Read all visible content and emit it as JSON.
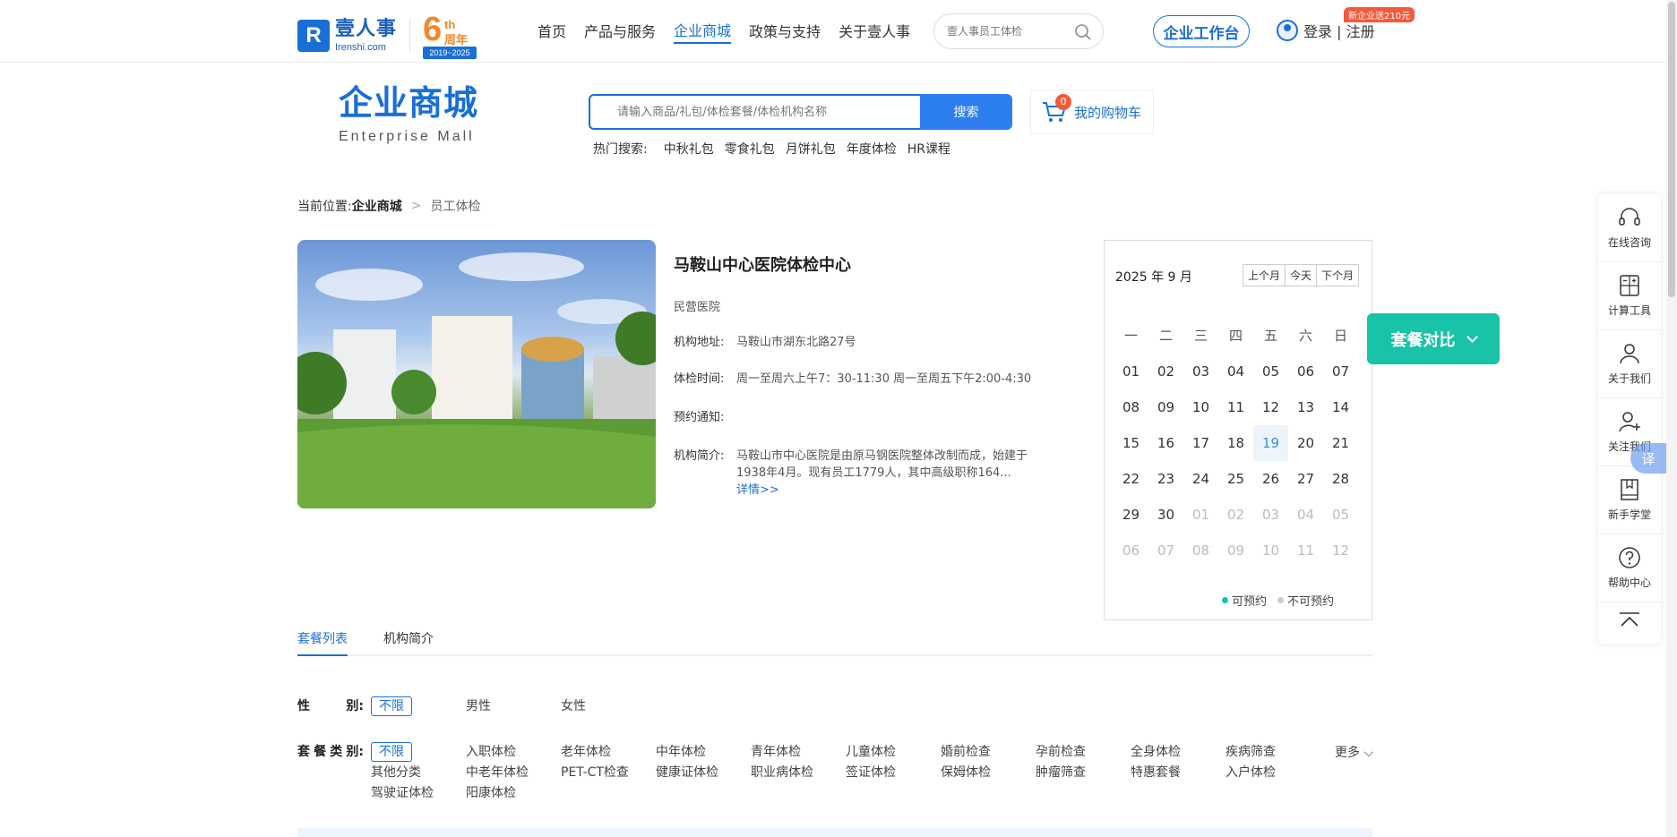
{
  "header": {
    "logo_cn": "壹人事",
    "logo_en": "Irenshi.com",
    "anniversary": {
      "num": "6",
      "suffix": "th",
      "zh": "周年",
      "years": "2019~2025"
    },
    "nav": [
      "首页",
      "产品与服务",
      "企业商城",
      "政策与支持",
      "关于壹人事"
    ],
    "search_placeholder": "壹人事员工体检",
    "workbench": "企业工作台",
    "login": "登录 | 注册",
    "promo": "新企业送210元"
  },
  "mall": {
    "title_cn": "企业商城",
    "title_en": "Enterprise  Mall",
    "search_placeholder": "请输入商品/礼包/体检套餐/体检机构名称",
    "search_button": "搜索",
    "hot_label": "热门搜索:",
    "hot_items": [
      "中秋礼包",
      "零食礼包",
      "月饼礼包",
      "年度体检",
      "HR课程"
    ],
    "cart_label": "我的购物车",
    "cart_count": "0"
  },
  "breadcrumb": {
    "prefix": "当前位置:",
    "link": "企业商城",
    "current": "员工体检"
  },
  "institution": {
    "name": "马鞍山中心医院体检中心",
    "type": "民营医院",
    "address_label": "机构地址:",
    "address": "马鞍山市湖东北路27号",
    "hours_label": "体检时间:",
    "hours": "周一至周六上午7：30-11:30 周一至周五下午2:00-4:30",
    "notice_label": "预约通知:",
    "notice": "",
    "intro_label": "机构简介:",
    "intro": "马鞍山市中心医院是由原马钢医院整体改制而成，始建于1938年4月。现有员工1779人，其中高级职称164...",
    "detail_link": "详情>>"
  },
  "calendar": {
    "title": "2025 年 9 月",
    "prev": "上个月",
    "today_btn": "今天",
    "next": "下个月",
    "weekdays": [
      "一",
      "二",
      "三",
      "四",
      "五",
      "六",
      "日"
    ],
    "weeks": [
      [
        "01",
        "02",
        "03",
        "04",
        "05",
        "06",
        "07"
      ],
      [
        "08",
        "09",
        "10",
        "11",
        "12",
        "13",
        "14"
      ],
      [
        "15",
        "16",
        "17",
        "18",
        "19",
        "20",
        "21"
      ],
      [
        "22",
        "23",
        "24",
        "25",
        "26",
        "27",
        "28"
      ],
      [
        "29",
        "30",
        "01",
        "02",
        "03",
        "04",
        "05"
      ],
      [
        "06",
        "07",
        "08",
        "09",
        "10",
        "11",
        "12"
      ]
    ],
    "today": "19",
    "legend_available": "可预约",
    "legend_unavailable": "不可预约",
    "available_color": "#18c3a8",
    "unavailable_color": "#cccccc"
  },
  "compare_button": "套餐对比",
  "tabs": [
    "套餐列表",
    "机构简介"
  ],
  "filters": {
    "gender_label": [
      "性",
      "别:"
    ],
    "gender_options": [
      "不限",
      "男性",
      "女性"
    ],
    "category_label": [
      "套",
      "餐",
      "类",
      "别:"
    ],
    "category_options": [
      "不限",
      "入职体检",
      "老年体检",
      "中年体检",
      "青年体检",
      "儿童体检",
      "婚前检查",
      "孕前检查",
      "全身体检",
      "疾病筛查",
      "其他分类",
      "中老年体检",
      "PET-CT检查",
      "健康证体检",
      "职业病体检",
      "签证体检",
      "保姆体检",
      "肿瘤筛查",
      "特惠套餐",
      "入户体检",
      "驾驶证体检",
      "阳康体检"
    ],
    "more": "更多"
  },
  "sidebar": [
    "在线咨询",
    "计算工具",
    "关于我们",
    "关注我们",
    "新手学堂",
    "帮助中心"
  ],
  "translate": "译",
  "colors": {
    "primary": "#1a6fd6",
    "accent": "#18c3a8",
    "badge": "#f35a3c",
    "anniversary": "#f0892a"
  }
}
